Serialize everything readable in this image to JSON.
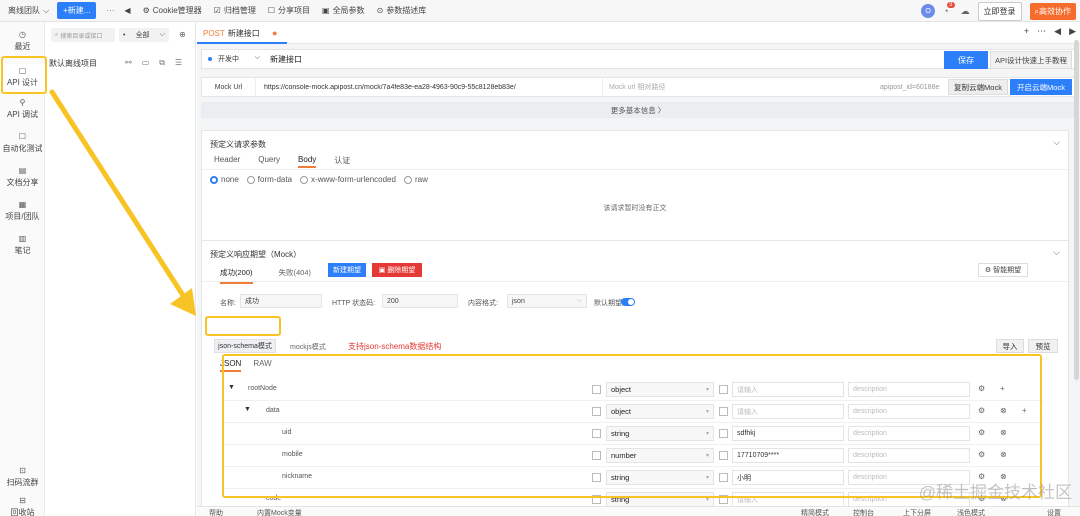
{
  "topbar": {
    "team": "离线团队",
    "new_button": "+新建...",
    "more": "···",
    "menus": [
      "Cookie管理器",
      "归档管理",
      "分享项目",
      "全局参数",
      "参数描述库"
    ],
    "avatar_letter": "O",
    "bell_badge": "3",
    "login_button": "立即登录",
    "collab_button": "高效协作"
  },
  "leftbar": {
    "items": [
      {
        "label": "最近",
        "icon": "clock-icon"
      },
      {
        "label": "API 设计",
        "icon": "design-icon"
      },
      {
        "label": "API 调试",
        "icon": "debug-icon"
      },
      {
        "label": "自动化测试",
        "icon": "automation-icon"
      },
      {
        "label": "文档分享",
        "icon": "doc-icon"
      },
      {
        "label": "项目/团队",
        "icon": "project-icon"
      },
      {
        "label": "笔记",
        "icon": "note-icon"
      },
      {
        "label": "扫码流群",
        "icon": "qr-icon"
      },
      {
        "label": "回收站",
        "icon": "trash-icon"
      }
    ]
  },
  "project_panel": {
    "search_placeholder": "搜索目录或接口",
    "scope": "全部",
    "project_name": "默认离线项目"
  },
  "tab": {
    "method": "POST",
    "title": "新建接口"
  },
  "request": {
    "status": "开发中",
    "name": "新建接口",
    "save": "保存",
    "guide": "API设计快速上手教程"
  },
  "mock_line": {
    "label": "Mock Url",
    "url": "https://console-mock.apipost.cn/mock/7a4fe83e-ea28-4963-90c9-55c8128eb83e/",
    "path_placeholder": "Mock url 相对路径",
    "api_id": "apipost_id=60188e",
    "copy_button": "复制云端Mock",
    "open_button": "开启云端Mock"
  },
  "more_info": "更多基本信息 〉",
  "request_params": {
    "title": "预定义请求参数",
    "tabs": [
      "Header",
      "Query",
      "Body",
      "认证"
    ],
    "active_tab": "Body",
    "body_modes": [
      "none",
      "form-data",
      "x-www-form-urlencoded",
      "raw"
    ],
    "active_mode": "none",
    "empty_text": "该请求暂时没有正文"
  },
  "mock_expect": {
    "title": "预定义响应期望（Mock）",
    "tabs": [
      "成功(200)",
      "失败(404)"
    ],
    "add_button": "新建期望",
    "delete_button": "删除期望",
    "smart_button": "智能期望",
    "name_label": "名称:",
    "name_value": "成功",
    "code_label": "HTTP 状态码:",
    "code_value": "200",
    "content_label": "内容格式:",
    "content_value": "json",
    "default_label": "默认期望",
    "mode_schema": "json-schema模式",
    "mode_mockjs": "mockjs模式",
    "annotation": "支持json-schema数据结构",
    "import_button": "导入",
    "preview_button": "预览",
    "json_tabs": [
      "JSON",
      "RAW"
    ]
  },
  "schema": {
    "placeholder": "请输入",
    "desc_placeholder": "description",
    "rows": [
      {
        "name": "rootNode",
        "type": "object",
        "mock": "",
        "level": 0,
        "expand": "▼"
      },
      {
        "name": "data",
        "type": "object",
        "mock": "",
        "level": 1,
        "expand": "▼"
      },
      {
        "name": "uid",
        "type": "string",
        "mock": "sdfhkj",
        "level": 2,
        "expand": ""
      },
      {
        "name": "mobile",
        "type": "number",
        "mock": "17710709****",
        "level": 2,
        "expand": ""
      },
      {
        "name": "nickname",
        "type": "string",
        "mock": "小明",
        "level": 2,
        "expand": ""
      },
      {
        "name": "code",
        "type": "string",
        "mock": "",
        "level": 1,
        "expand": ""
      }
    ]
  },
  "footer": {
    "help": "帮助",
    "builtin": "内置Mock变量",
    "compact": "精简模式",
    "console": "控制台",
    "split": "上下分屏",
    "theme": "浅色模式",
    "settings": "设置"
  },
  "watermark": "@稀土掘金技术社区"
}
